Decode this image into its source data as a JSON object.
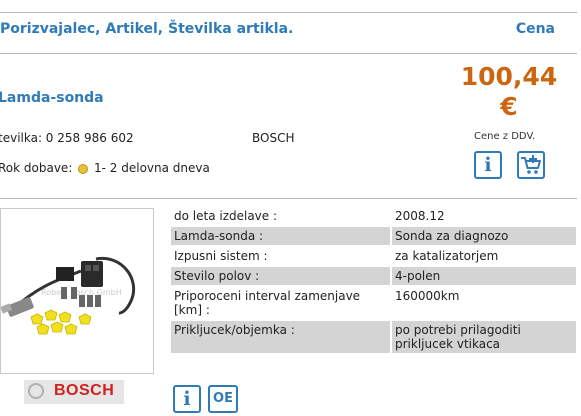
{
  "header": {
    "title": "Porizvajalec, Artikel, Številka artikla.",
    "price_label": "Cena"
  },
  "product": {
    "name": "Lamda-sonda",
    "article_number": "tevilka: 0 258 986 602",
    "brand": "BOSCH",
    "delivery_label": "Rok dobave:",
    "delivery_value": "1- 2 delovna dneva",
    "price": "100,44",
    "currency": "€",
    "vat_note": "Cene z DDV."
  },
  "buttons": {
    "info": "i",
    "oe": "OE"
  },
  "image": {
    "watermark": "Robert Bosch GmbH",
    "logo_text": "BOSCH"
  },
  "specs": [
    {
      "key": "do leta izdelave :",
      "value": "2008.12"
    },
    {
      "key": "Lamda-sonda :",
      "value": "Sonda za diagnozo"
    },
    {
      "key": "Izpusni sistem :",
      "value": "za katalizatorjem"
    },
    {
      "key": "Stevilo polov :",
      "value": "4-polen"
    },
    {
      "key": "Priporoceni interval zamenjave [km] :",
      "value": "160000km"
    },
    {
      "key": "Prikljucek/objemka :",
      "value": "po potrebi prilagoditi prikljucek vtikaca"
    }
  ],
  "colors": {
    "accent": "#2f7bb8",
    "price": "#cc6611",
    "row_alt": "#d4d4d4",
    "brand_red": "#d21f1f"
  }
}
